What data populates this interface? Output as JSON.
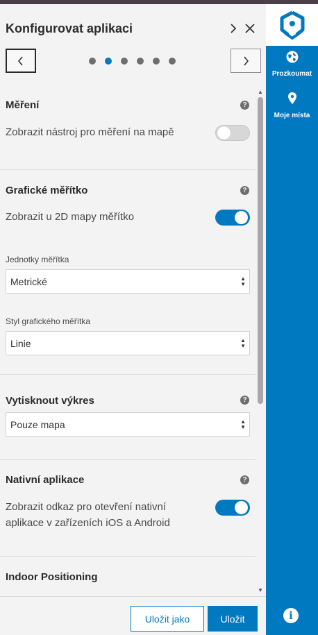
{
  "header": {
    "title": "Konfigurovat aplikaci"
  },
  "stepper": {
    "total_steps": 6,
    "active_step": 2
  },
  "sections": {
    "measurement": {
      "title": "Měření",
      "toggle_label": "Zobrazit nástroj pro měření na mapě",
      "toggle_on": false
    },
    "scalebar": {
      "title": "Grafické měřítko",
      "toggle_label": "Zobrazit u 2D mapy měřítko",
      "toggle_on": true,
      "units_label": "Jednotky měřítka",
      "units_value": "Metrické",
      "style_label": "Styl grafického měřítka",
      "style_value": "Linie"
    },
    "print": {
      "title": "Vytisknout výkres",
      "value": "Pouze mapa"
    },
    "native": {
      "title": "Nativní aplikace",
      "toggle_label": "Zobrazit odkaz pro otevření nativní aplikace v zařízeních iOS a Android",
      "toggle_on": true
    },
    "indoor": {
      "title": "Indoor Positioning"
    }
  },
  "footer": {
    "save_as_label": "Uložit jako",
    "save_label": "Uložit"
  },
  "rail": {
    "explore_label": "Prozkoumat",
    "places_label": "Moje místa"
  },
  "colors": {
    "accent": "#0079c1",
    "panel_bg": "#f3f3f3"
  }
}
